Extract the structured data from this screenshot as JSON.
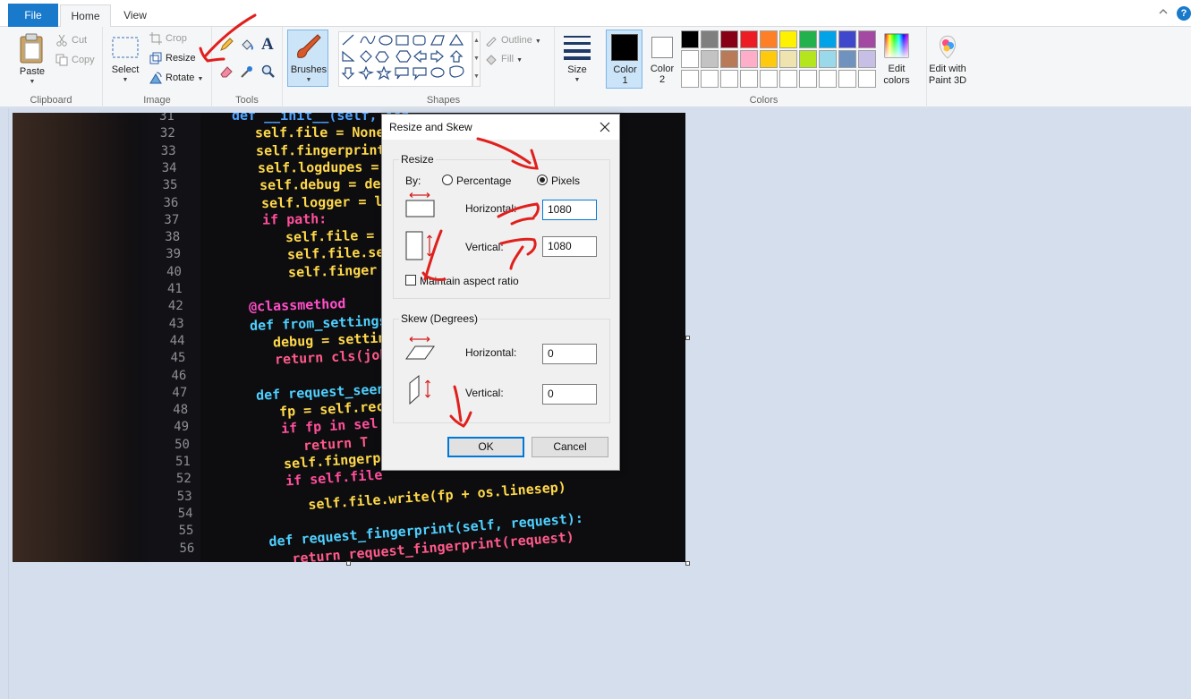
{
  "tabs": {
    "file": "File",
    "home": "Home",
    "view": "View"
  },
  "window_controls": {
    "help": "?"
  },
  "ribbon": {
    "clipboard": {
      "paste": "Paste",
      "cut": "Cut",
      "copy": "Copy",
      "group": "Clipboard"
    },
    "image": {
      "select": "Select",
      "crop": "Crop",
      "resize": "Resize",
      "rotate": "Rotate",
      "group": "Image"
    },
    "tools": {
      "group": "Tools",
      "text_glyph": "A"
    },
    "brushes": {
      "label": "Brushes"
    },
    "shapes": {
      "outline": "Outline",
      "fill": "Fill",
      "group": "Shapes"
    },
    "size": {
      "label": "Size"
    },
    "colors": {
      "color1_label": "Color",
      "color1_num": "1",
      "color2_label": "Color",
      "color2_num": "2",
      "edit_colors": "Edit colors",
      "edit_3d": "Edit with Paint 3D",
      "group": "Colors",
      "color1": "#000000",
      "color2": "#ffffff",
      "palette_row1": [
        "#000000",
        "#7f7f7f",
        "#880015",
        "#ed1c24",
        "#ff7f27",
        "#fff200",
        "#22b14c",
        "#00a2e8",
        "#3f48cc",
        "#a349a4"
      ],
      "palette_row2": [
        "#ffffff",
        "#c3c3c3",
        "#b97a57",
        "#ffaec9",
        "#ffc90e",
        "#efe4b0",
        "#b5e61d",
        "#99d9ea",
        "#7092be",
        "#c8bfe7"
      ],
      "palette_row3": [
        "#ffffff",
        "#ffffff",
        "#ffffff",
        "#ffffff",
        "#ffffff",
        "#ffffff",
        "#ffffff",
        "#ffffff",
        "#ffffff",
        "#ffffff"
      ]
    }
  },
  "photo": {
    "line_numbers": [
      "31",
      "32",
      "33",
      "34",
      "35",
      "36",
      "37",
      "38",
      "39",
      "40",
      "41",
      "42",
      "43",
      "44",
      "45",
      "46",
      "47",
      "48",
      "49",
      "50",
      "51",
      "52",
      "53",
      "54",
      "55",
      "56"
    ],
    "code_lines": [
      {
        "text": "def __init__(self, job",
        "color": "#4fa3ff"
      },
      {
        "text": "self.file = None",
        "color": "#ffd84a"
      },
      {
        "text": "self.fingerprints",
        "color": "#ffd84a"
      },
      {
        "text": "self.logdupes = T",
        "color": "#ffd84a"
      },
      {
        "text": "self.debug = debu",
        "color": "#ffd84a"
      },
      {
        "text": "self.logger = lo",
        "color": "#ffd84a"
      },
      {
        "text": "if path:",
        "color": "#ff4f9a"
      },
      {
        "text": "self.file = ",
        "color": "#ffd84a"
      },
      {
        "text": "self.file.se",
        "color": "#ffd84a"
      },
      {
        "text": "self.finger",
        "color": "#ffd84a"
      },
      {
        "text": "",
        "color": "#ffd84a"
      },
      {
        "text": "@classmethod",
        "color": "#ff4fc8"
      },
      {
        "text": "def from_settings(",
        "color": "#4fd0ff"
      },
      {
        "text": "debug = settin",
        "color": "#ffd84a"
      },
      {
        "text": "return cls(job",
        "color": "#ff5a8a"
      },
      {
        "text": "",
        "color": "#ffd84a"
      },
      {
        "text": "def request_seen(",
        "color": "#4fd0ff"
      },
      {
        "text": "fp = self.rec",
        "color": "#ffd84a"
      },
      {
        "text": "if fp in sel",
        "color": "#ff4f9a"
      },
      {
        "text": "return T",
        "color": "#ff5a8a"
      },
      {
        "text": "self.fingerp",
        "color": "#ffd84a"
      },
      {
        "text": "if self.file",
        "color": "#ff4f9a"
      },
      {
        "text": "self.file.write(fp + os.linesep)",
        "color": "#ffd84a"
      },
      {
        "text": "",
        "color": "#ffd84a"
      },
      {
        "text": "def request_fingerprint(self, request):",
        "color": "#4fd0ff"
      },
      {
        "text": "return request_fingerprint(request)",
        "color": "#ff5a8a"
      }
    ]
  },
  "dialog": {
    "title": "Resize and Skew",
    "resize": {
      "legend": "Resize",
      "by_label": "By:",
      "percentage": "Percentage",
      "pixels": "Pixels",
      "horizontal_label": "Horizontal:",
      "horizontal_value": "1080",
      "vertical_label": "Vertical:",
      "vertical_value": "1080",
      "maintain_aspect": "Maintain aspect ratio",
      "selected_unit": "Pixels",
      "maintain_checked": false
    },
    "skew": {
      "legend": "Skew (Degrees)",
      "horizontal_label": "Horizontal:",
      "horizontal_value": "0",
      "vertical_label": "Vertical:",
      "vertical_value": "0"
    },
    "ok": "OK",
    "cancel": "Cancel"
  },
  "annotation_color": "#e0201d"
}
